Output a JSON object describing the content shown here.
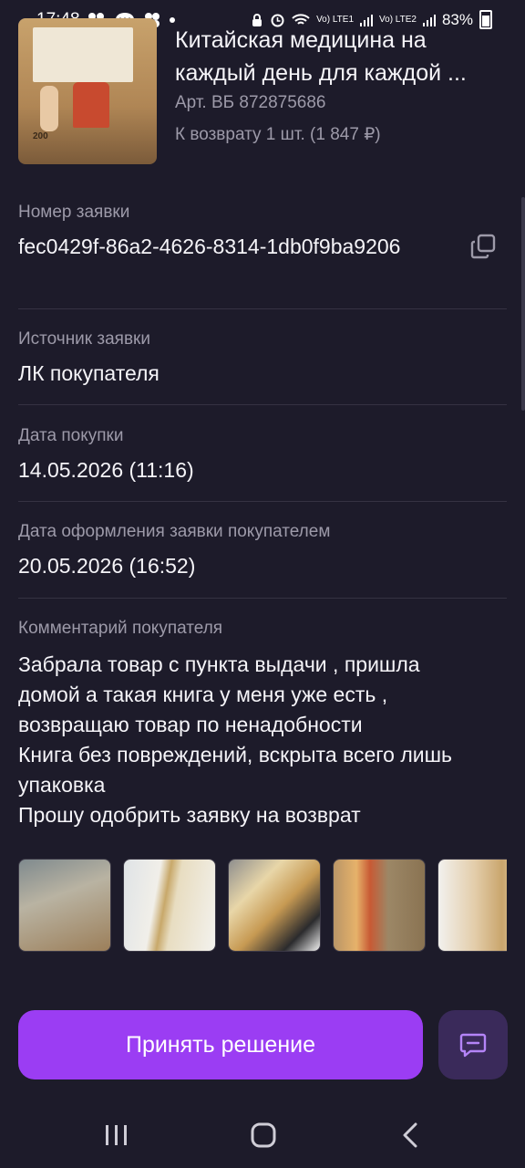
{
  "status_bar": {
    "time": "17:48",
    "signal_1": "Vo) LTE1",
    "signal_2": "Vo) LTE2",
    "battery": "83%"
  },
  "product": {
    "title": "Китайская медицина на каждый день для каждой ...",
    "article": "Арт. ВБ 872875686",
    "return_info": "К возврату 1 шт. (1 847 ₽)",
    "cover_number": "200"
  },
  "fields": [
    {
      "label": "Номер заявки",
      "value": "fec0429f-86a2-4626-8314-1db0f9ba9206"
    },
    {
      "label": "Источник заявки",
      "value": "ЛК покупателя"
    },
    {
      "label": "Дата покупки",
      "value": "14.05.2026 (11:16)"
    },
    {
      "label": "Дата оформления заявки покупателем",
      "value": "20.05.2026 (16:52)"
    }
  ],
  "comment": {
    "label": "Комментарий покупателя",
    "line_1": "Забрала товар с пункта выдачи , пришла",
    "line_2": "домой а такая книга у меня уже есть ,",
    "line_3": "возвращаю товар по ненадобности",
    "line_4": "Книга без повреждений, вскрыта всего лишь",
    "line_5": "упаковка",
    "line_6": "Прошу одобрить заявку на возврат"
  },
  "actions": {
    "primary_label": "Принять решение",
    "chat_icon": "chat-icon",
    "accent_color": "#9b3df3"
  },
  "icons": {
    "copy": "copy-icon",
    "nav_recents": "recents-icon",
    "nav_home": "home-icon",
    "nav_back": "back-icon"
  }
}
